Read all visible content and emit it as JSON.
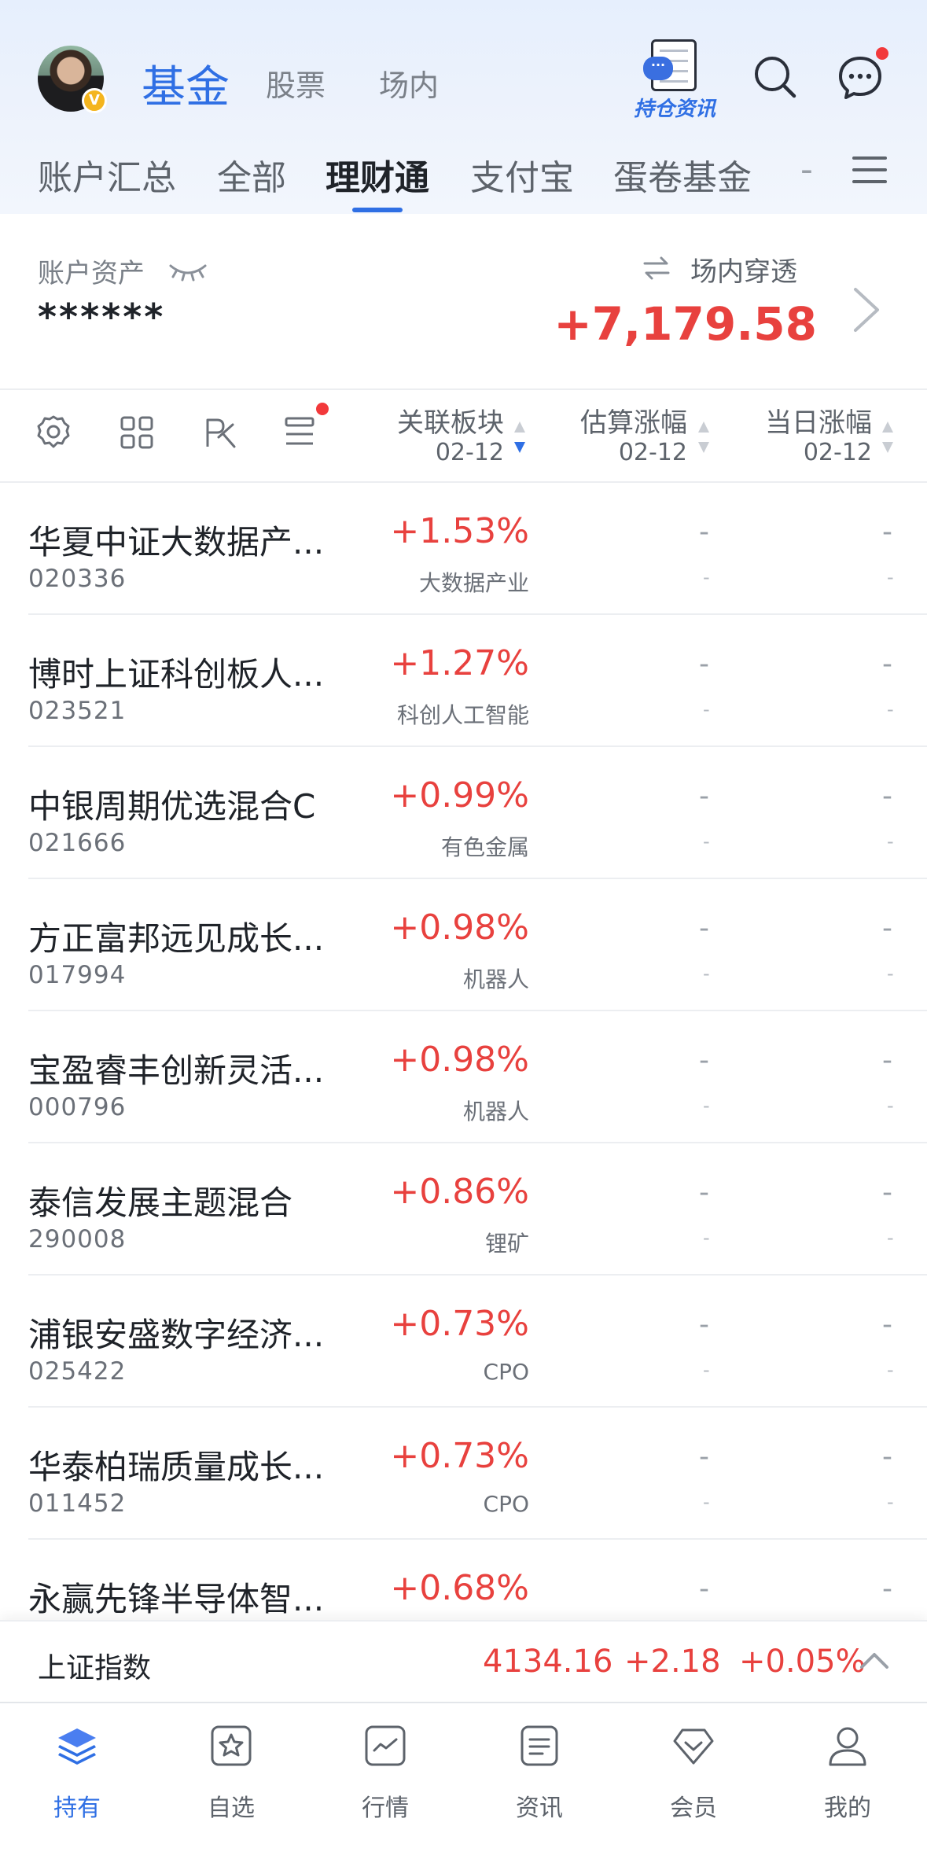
{
  "header": {
    "tabs": [
      {
        "label": "基金",
        "active": true
      },
      {
        "label": "股票",
        "active": false
      },
      {
        "label": "场内",
        "active": false
      }
    ],
    "hold_news_label": "持仓资讯",
    "avatar_badge": "V",
    "subtabs": [
      {
        "label": "账户汇总",
        "active": false
      },
      {
        "label": "全部",
        "active": false
      },
      {
        "label": "理财通",
        "active": true
      },
      {
        "label": "支付宝",
        "active": false
      },
      {
        "label": "蛋卷基金",
        "active": false
      },
      {
        "label": "-",
        "active": false
      }
    ]
  },
  "assets": {
    "label": "账户资产",
    "masked_value": "******",
    "penetrate_label": "场内穿透",
    "profit": "+7,179.58"
  },
  "columns": {
    "related_sector": {
      "title": "关联板块",
      "date": "02-12"
    },
    "estimated_change": {
      "title": "估算涨幅",
      "date": "02-12"
    },
    "day_change": {
      "title": "当日涨幅",
      "date": "02-12"
    }
  },
  "funds": [
    {
      "name": "华夏中证大数据产...",
      "code": "020336",
      "sector_change": "+1.53%",
      "sector": "大数据产业",
      "est": "-",
      "est_sub": "-",
      "day": "-",
      "day_sub": "-"
    },
    {
      "name": "博时上证科创板人...",
      "code": "023521",
      "sector_change": "+1.27%",
      "sector": "科创人工智能",
      "est": "-",
      "est_sub": "-",
      "day": "-",
      "day_sub": "-"
    },
    {
      "name": "中银周期优选混合C",
      "code": "021666",
      "sector_change": "+0.99%",
      "sector": "有色金属",
      "est": "-",
      "est_sub": "-",
      "day": "-",
      "day_sub": "-"
    },
    {
      "name": "方正富邦远见成长...",
      "code": "017994",
      "sector_change": "+0.98%",
      "sector": "机器人",
      "est": "-",
      "est_sub": "-",
      "day": "-",
      "day_sub": "-"
    },
    {
      "name": "宝盈睿丰创新灵活...",
      "code": "000796",
      "sector_change": "+0.98%",
      "sector": "机器人",
      "est": "-",
      "est_sub": "-",
      "day": "-",
      "day_sub": "-"
    },
    {
      "name": "泰信发展主题混合",
      "code": "290008",
      "sector_change": "+0.86%",
      "sector": "锂矿",
      "est": "-",
      "est_sub": "-",
      "day": "-",
      "day_sub": "-"
    },
    {
      "name": "浦银安盛数字经济...",
      "code": "025422",
      "sector_change": "+0.73%",
      "sector": "CPO",
      "est": "-",
      "est_sub": "-",
      "day": "-",
      "day_sub": "-"
    },
    {
      "name": "华泰柏瑞质量成长...",
      "code": "011452",
      "sector_change": "+0.73%",
      "sector": "CPO",
      "est": "-",
      "est_sub": "-",
      "day": "-",
      "day_sub": "-"
    },
    {
      "name": "永赢先锋半导体智...",
      "code": "",
      "sector_change": "+0.68%",
      "sector": "",
      "est": "-",
      "est_sub": "",
      "day": "-",
      "day_sub": ""
    }
  ],
  "index_bar": {
    "name": "上证指数",
    "value": "4134.16",
    "change": "+2.18",
    "change_pct": "+0.05%"
  },
  "tabbar": [
    {
      "label": "持有",
      "icon": "layers-icon",
      "active": true
    },
    {
      "label": "自选",
      "icon": "star-icon",
      "active": false
    },
    {
      "label": "行情",
      "icon": "chart-icon",
      "active": false
    },
    {
      "label": "资讯",
      "icon": "news-icon",
      "active": false
    },
    {
      "label": "会员",
      "icon": "diamond-icon",
      "active": false
    },
    {
      "label": "我的",
      "icon": "user-icon",
      "active": false
    }
  ],
  "colors": {
    "accent": "#2f6fe4",
    "up": "#e8413e",
    "badge_red": "#f2393b"
  }
}
